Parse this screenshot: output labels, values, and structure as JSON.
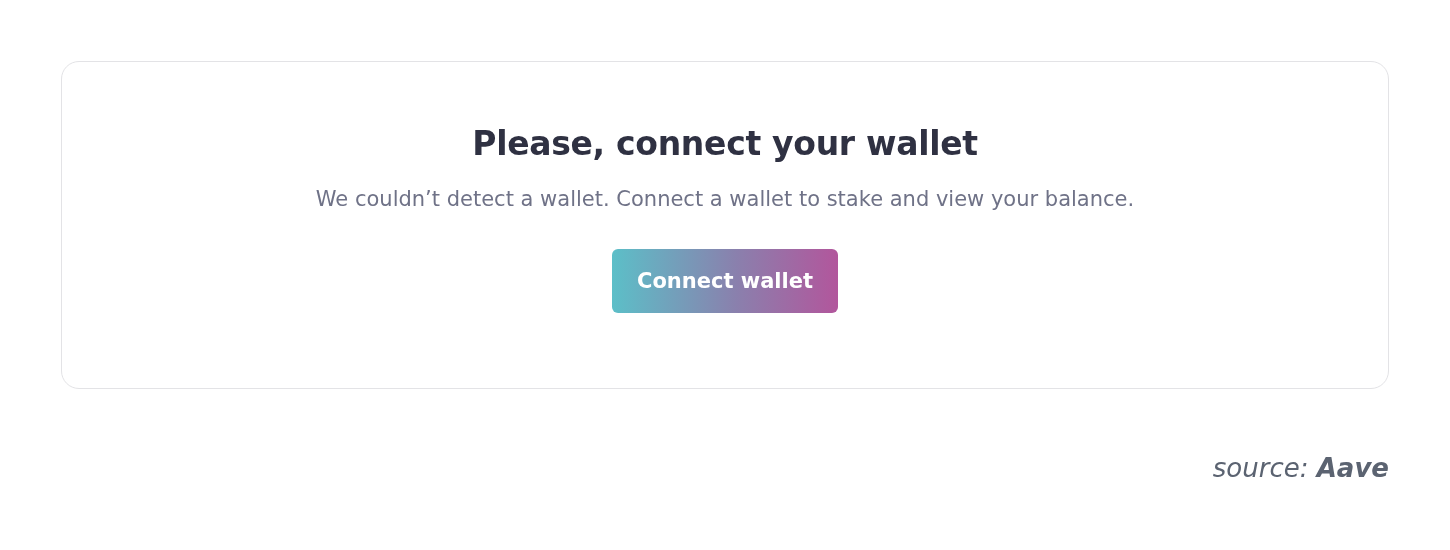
{
  "card": {
    "title": "Please, connect your wallet",
    "message": "We couldn’t detect a wallet. Connect a wallet to stake and view your balance.",
    "button": "Connect wallet"
  },
  "caption": "source: **Aave**"
}
